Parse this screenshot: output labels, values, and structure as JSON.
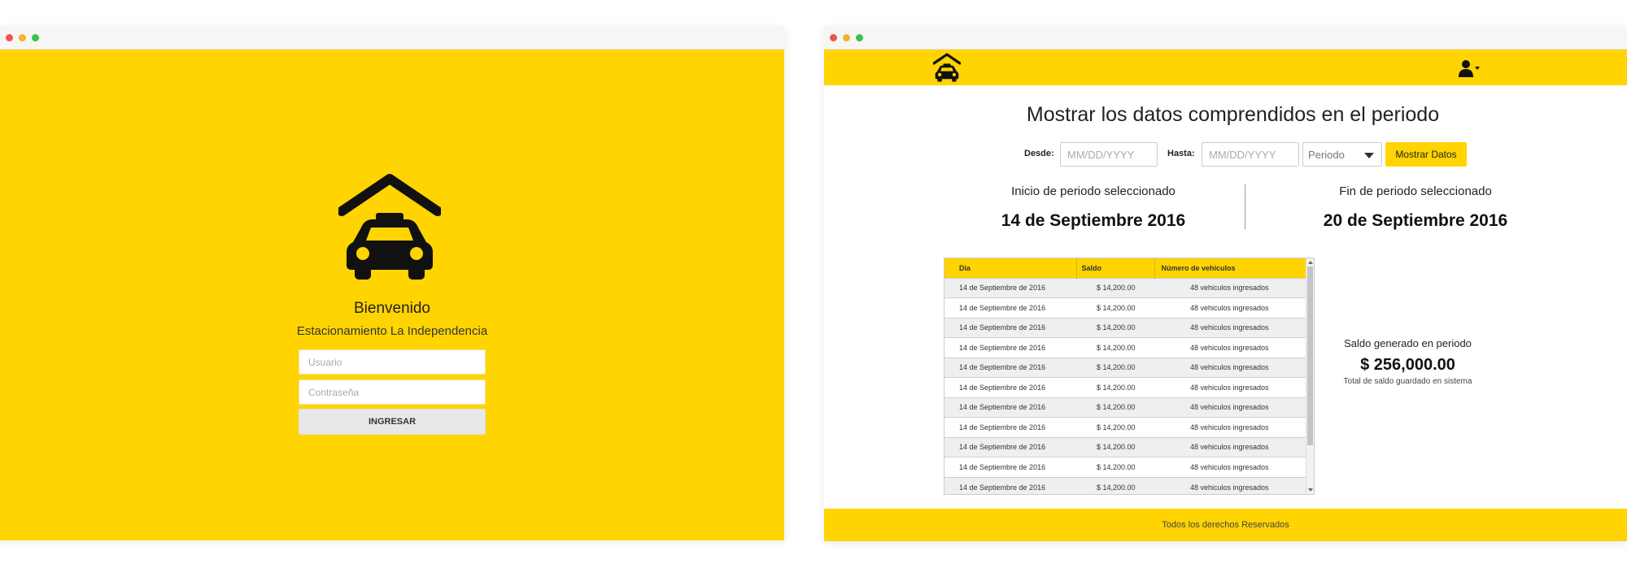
{
  "login": {
    "welcome": "Bienvenido",
    "subtitle": "Estacionamiento La Independencia",
    "username_placeholder": "Usuario",
    "password_placeholder": "Contraseña",
    "submit_label": "INGRESAR"
  },
  "dashboard": {
    "title": "Mostrar los datos comprendidos en el periodo",
    "filters": {
      "from_label": "Desde:",
      "from_placeholder": "MM/DD/YYYY",
      "to_label": "Hasta:",
      "to_placeholder": "MM/DD/YYYY",
      "period_select": "Periodo",
      "show_button": "Mostrar Datos"
    },
    "period_start": {
      "label": "Inicio de periodo seleccionado",
      "date": "14 de Septiembre 2016"
    },
    "period_end": {
      "label": "Fin de periodo seleccionado",
      "date": "20 de Septiembre 2016"
    },
    "table": {
      "headers": [
        "Dia",
        "Saldo",
        "Número de vehiculos"
      ],
      "rows": [
        [
          "14 de Septiembre de 2016",
          "$ 14,200.00",
          "48 vehiculos ingresados"
        ],
        [
          "14 de Septiembre de 2016",
          "$ 14,200.00",
          "48 vehiculos ingresados"
        ],
        [
          "14 de Septiembre de 2016",
          "$ 14,200.00",
          "48 vehiculos ingresados"
        ],
        [
          "14 de Septiembre de 2016",
          "$ 14,200.00",
          "48 vehiculos ingresados"
        ],
        [
          "14 de Septiembre de 2016",
          "$ 14,200.00",
          "48 vehiculos ingresados"
        ],
        [
          "14 de Septiembre de 2016",
          "$ 14,200.00",
          "48 vehiculos ingresados"
        ],
        [
          "14 de Septiembre de 2016",
          "$ 14,200.00",
          "48 vehiculos ingresados"
        ],
        [
          "14 de Septiembre de 2016",
          "$ 14,200.00",
          "48 vehiculos ingresados"
        ],
        [
          "14 de Septiembre de 2016",
          "$ 14,200.00",
          "48 vehiculos ingresados"
        ],
        [
          "14 de Septiembre de 2016",
          "$ 14,200.00",
          "48 vehiculos ingresados"
        ],
        [
          "14 de Septiembre de 2016",
          "$ 14,200.00",
          "48 vehiculos ingresados"
        ]
      ]
    },
    "summary": {
      "label": "Saldo generado en periodo",
      "value": "$ 256,000.00",
      "note": "Total de saldo guardado en sistema"
    },
    "footer": "Todos los derechos Reservados"
  },
  "colors": {
    "brand_yellow": "#ffd401"
  },
  "icons": {
    "logo": "garage-car-icon",
    "user": "user-icon"
  }
}
